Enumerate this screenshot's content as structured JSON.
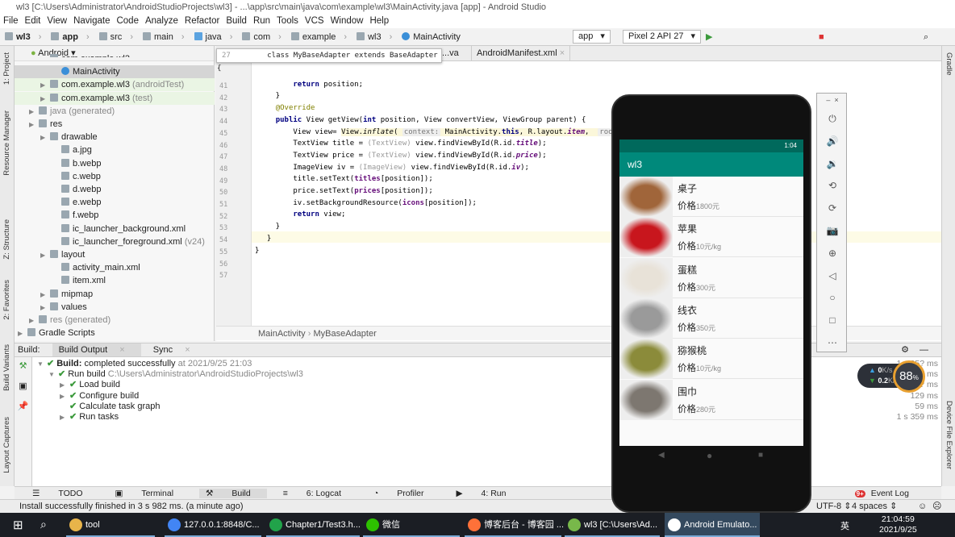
{
  "window": {
    "title": "wl3 [C:\\Users\\Administrator\\AndroidStudioProjects\\wl3] - ...\\app\\src\\main\\java\\com\\example\\wl3\\MainActivity.java [app] - Android Studio"
  },
  "menu": [
    "File",
    "Edit",
    "View",
    "Navigate",
    "Code",
    "Analyze",
    "Refactor",
    "Build",
    "Run",
    "Tools",
    "VCS",
    "Window",
    "Help"
  ],
  "nav": {
    "crumbs": [
      "wl3",
      "app",
      "src",
      "main",
      "java",
      "com",
      "example",
      "wl3",
      "MainActivity"
    ],
    "run_config": "app",
    "device": "Pixel 2 API 27"
  },
  "left_strip": [
    "1: Project",
    "Resource Manager",
    "Z: Structure",
    "2: Favorites",
    "Build Variants",
    "Layout Captures"
  ],
  "right_strip": [
    "Gradle",
    "Device File Explorer"
  ],
  "project": {
    "view": "Android",
    "items": [
      {
        "label": "com.example.wl3",
        "depth": 2,
        "cut": true
      },
      {
        "label": "MainActivity",
        "depth": 3,
        "selected": true
      },
      {
        "label": "com.example.wl3",
        "suffix": "(androidTest)",
        "depth": 2,
        "green": true
      },
      {
        "label": "com.example.wl3",
        "suffix": "(test)",
        "depth": 2,
        "green": true
      },
      {
        "label": "java (generated)",
        "depth": 1,
        "grey": true
      },
      {
        "label": "res",
        "depth": 1
      },
      {
        "label": "drawable",
        "depth": 2
      },
      {
        "label": "a.jpg",
        "depth": 3
      },
      {
        "label": "b.webp",
        "depth": 3
      },
      {
        "label": "c.webp",
        "depth": 3
      },
      {
        "label": "d.webp",
        "depth": 3
      },
      {
        "label": "e.webp",
        "depth": 3
      },
      {
        "label": "f.webp",
        "depth": 3
      },
      {
        "label": "ic_launcher_background.xml",
        "depth": 3
      },
      {
        "label": "ic_launcher_foreground.xml",
        "suffix": "(v24)",
        "depth": 3
      },
      {
        "label": "layout",
        "depth": 2
      },
      {
        "label": "activity_main.xml",
        "depth": 3
      },
      {
        "label": "item.xml",
        "depth": 3
      },
      {
        "label": "mipmap",
        "depth": 2
      },
      {
        "label": "values",
        "depth": 2
      },
      {
        "label": "res (generated)",
        "depth": 1,
        "grey": true
      },
      {
        "label": "Gradle Scripts",
        "depth": 0
      }
    ]
  },
  "editor": {
    "tabs": [
      "...va",
      "AndroidManifest.xml"
    ],
    "sticky": {
      "line": "27",
      "text": "class MyBaseAdapter extends BaseAdapter {"
    },
    "lines": [
      "41",
      "42",
      "43",
      "44",
      "45",
      "46",
      "47",
      "48",
      "49",
      "50",
      "51",
      "52",
      "53",
      "54",
      "55",
      "56",
      "57"
    ],
    "breadcrumb": [
      "MainActivity",
      "MyBaseAdapter"
    ]
  },
  "build": {
    "label": "Build:",
    "tabs": [
      "Build Output",
      "Sync"
    ],
    "tree": [
      {
        "bold": "Build:",
        "text": "completed successfully",
        "grey": "at 2021/9/25 21:03"
      },
      {
        "text": "Run build",
        "grey": "C:\\Users\\Administrator\\AndroidStudioProjects\\wl3"
      },
      {
        "text": "Load build"
      },
      {
        "text": "Configure build"
      },
      {
        "text": "Calculate task graph"
      },
      {
        "text": "Run tasks"
      }
    ],
    "times": [
      "1 s 95? ms",
      "?73 ms",
      "? ms",
      "129 ms",
      "59 ms",
      "1 s 359 ms"
    ]
  },
  "bottom_tabs": [
    "TODO",
    "Terminal",
    "Build",
    "6: Logcat",
    "Profiler",
    "4: Run",
    "Event Log"
  ],
  "status": {
    "message": "Install successfully finished in 3 s 982 ms. (a minute ago)",
    "encoding": "UTF-8",
    "indent": "4 spaces"
  },
  "net_widget": {
    "up": "0",
    "down": "0.2",
    "unit": "K/s",
    "percent": "88"
  },
  "phone": {
    "time": "1:04",
    "app_title": "wl3",
    "price_label": "价格",
    "items": [
      {
        "title": "桌子",
        "price": "1800元",
        "color": "#a0653a"
      },
      {
        "title": "苹果",
        "price": "10元/kg",
        "color": "#c8161d"
      },
      {
        "title": "蛋糕",
        "price": "300元",
        "color": "#e8e2d8"
      },
      {
        "title": "线衣",
        "price": "350元",
        "color": "#9a9a9a"
      },
      {
        "title": "猕猴桃",
        "price": "10元/kg",
        "color": "#8b8b3a"
      },
      {
        "title": "围巾",
        "price": "280元",
        "color": "#7d7770"
      }
    ]
  },
  "taskbar": {
    "items": [
      "tool",
      "127.0.0.1:8848/C...",
      "Chapter1/Test3.h...",
      "微信",
      "博客后台 - 博客园 ...",
      "wl3 [C:\\Users\\Ad...",
      "Android Emulato..."
    ],
    "time": "21:04:59",
    "date": "2021/9/25",
    "ime": "英"
  },
  "colors": {
    "accent": "#00897b",
    "statusbar": "#00695c"
  }
}
